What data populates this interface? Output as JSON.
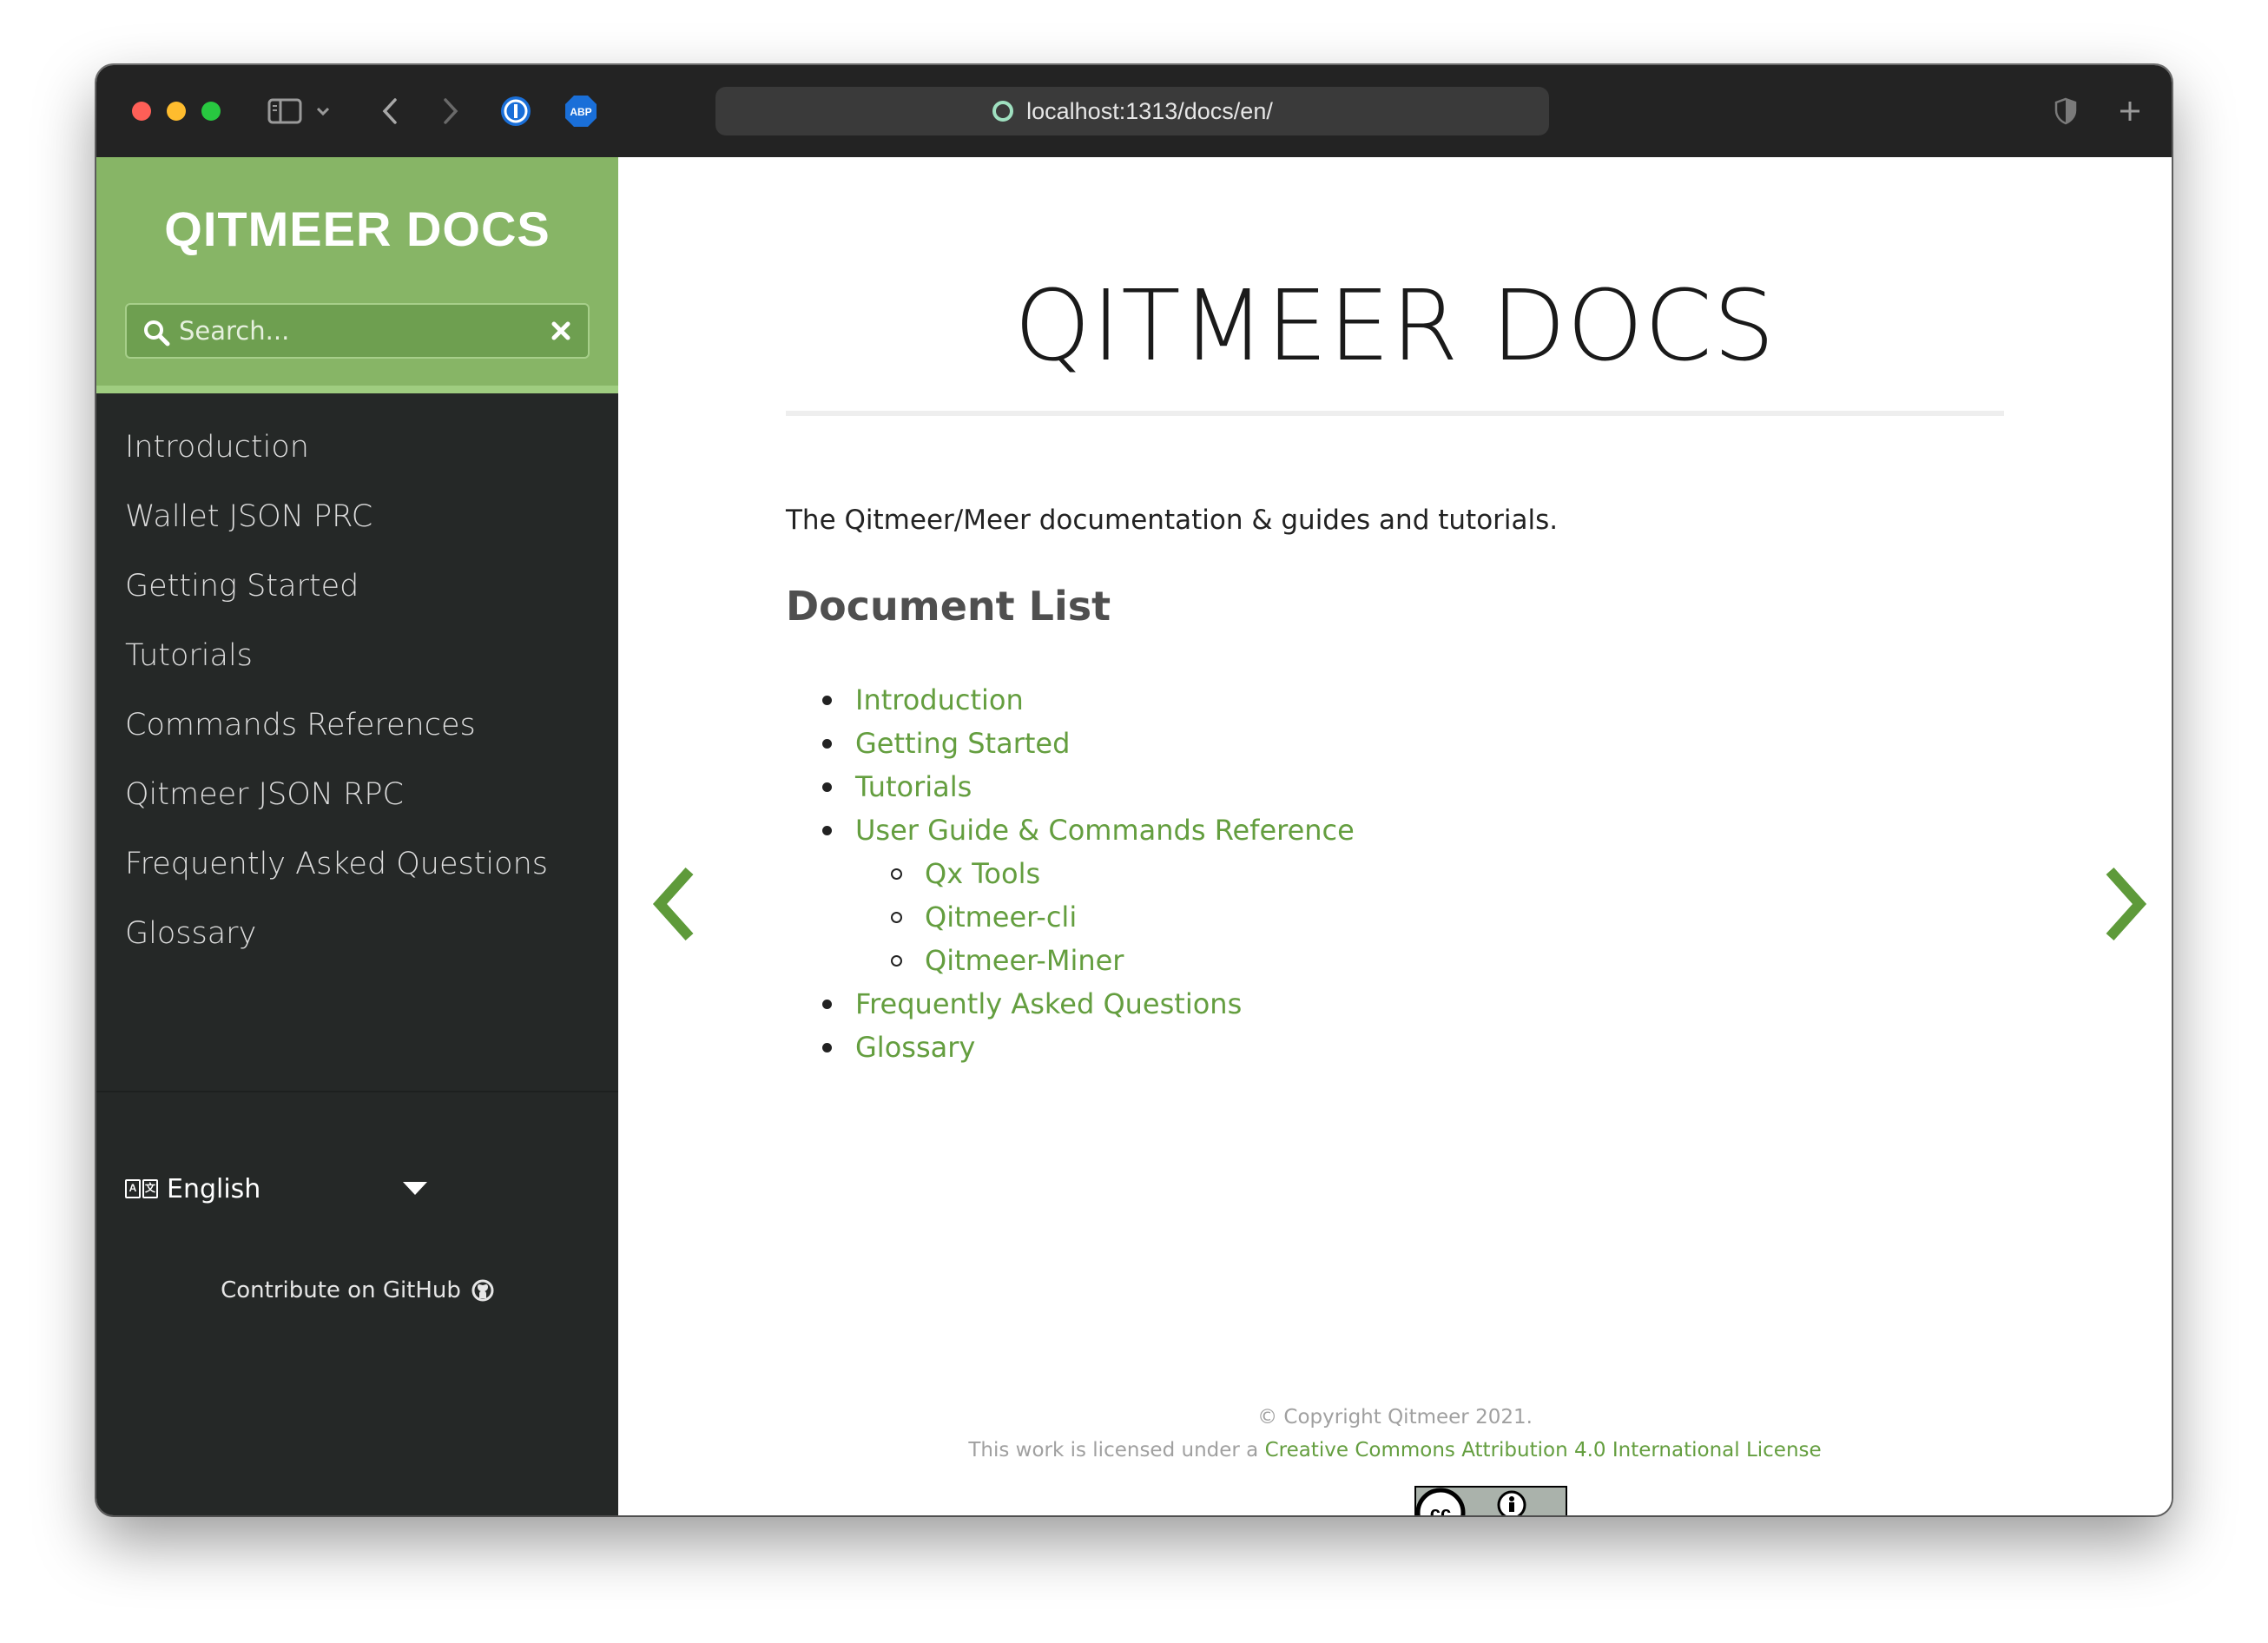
{
  "browser": {
    "url": "localhost:1313/docs/en/",
    "icons": [
      "sidebar-toggle-icon",
      "chevron-down-icon",
      "back-icon",
      "forward-icon",
      "onepassword-icon",
      "adblock-icon",
      "shield-icon",
      "new-tab-icon",
      "page-loading-icon"
    ]
  },
  "sidebar": {
    "brand": "QITMEER DOCS",
    "search": {
      "placeholder": "Search..."
    },
    "items": [
      {
        "label": "Introduction"
      },
      {
        "label": "Wallet JSON PRC"
      },
      {
        "label": "Getting Started"
      },
      {
        "label": "Tutorials"
      },
      {
        "label": "Commands References"
      },
      {
        "label": "Qitmeer JSON RPC"
      },
      {
        "label": "Frequently Asked Questions"
      },
      {
        "label": "Glossary"
      }
    ],
    "language": {
      "selected": "English"
    },
    "github": {
      "label": "Contribute on GitHub"
    }
  },
  "main": {
    "title": "QITMEER DOCS",
    "intro": "The Qitmeer/Meer documentation & guides and tutorials.",
    "section_title": "Document List",
    "list": [
      {
        "label": "Introduction",
        "level": 1
      },
      {
        "label": "Getting Started",
        "level": 1
      },
      {
        "label": "Tutorials",
        "level": 1
      },
      {
        "label": "User Guide & Commands Reference",
        "level": 1
      },
      {
        "label": "Qx Tools",
        "level": 2
      },
      {
        "label": "Qitmeer-cli",
        "level": 2
      },
      {
        "label": "Qitmeer-Miner",
        "level": 2
      },
      {
        "label": "Frequently Asked Questions",
        "level": 1
      },
      {
        "label": "Glossary",
        "level": 1
      }
    ]
  },
  "footer": {
    "copyright": "© Copyright Qitmeer 2021.",
    "license_prefix": "This work is licensed under a ",
    "license_link": "Creative Commons Attribution 4.0 International License",
    "badge_text": "BY"
  },
  "colors": {
    "accent_green": "#87b566",
    "link_green": "#649e3f",
    "sidebar_dark": "#252827",
    "toolbar": "#232323"
  }
}
